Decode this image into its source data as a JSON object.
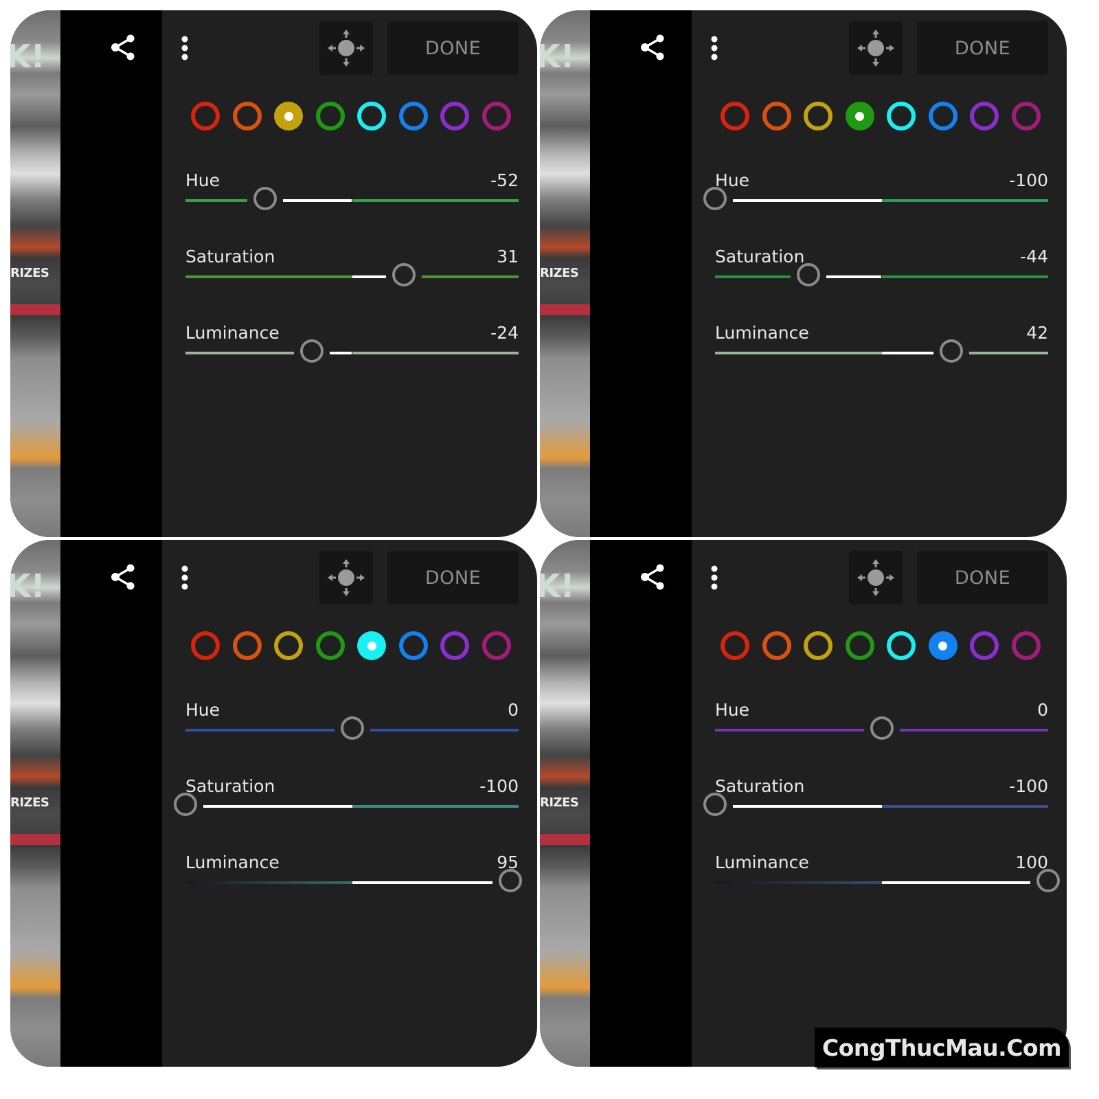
{
  "screens": [
    {
      "id": "top-left",
      "toolbar": {
        "done_label": "DONE"
      },
      "swatches": [
        {
          "name": "red",
          "color": "#d8240e"
        },
        {
          "name": "orange",
          "color": "#d9520f"
        },
        {
          "name": "yellow",
          "color": "#c2a20f",
          "active": true
        },
        {
          "name": "green",
          "color": "#1f9a12"
        },
        {
          "name": "aqua",
          "color": "#19f0f2"
        },
        {
          "name": "blue",
          "color": "#1282f0"
        },
        {
          "name": "purple",
          "color": "#8a2ecc"
        },
        {
          "name": "magenta",
          "color": "#a31c78"
        }
      ],
      "sliders": [
        {
          "label": "Hue",
          "value": -52,
          "display": "-52",
          "track_color": "#37a24b"
        },
        {
          "label": "Saturation",
          "value": 31,
          "display": "31",
          "track_color": "#4f9a26"
        },
        {
          "label": "Luminance",
          "value": -24,
          "display": "-24",
          "track_color": "#9cb397"
        }
      ]
    },
    {
      "id": "top-right",
      "toolbar": {
        "done_label": "DONE"
      },
      "swatches": [
        {
          "name": "red",
          "color": "#d8240e"
        },
        {
          "name": "orange",
          "color": "#d9520f"
        },
        {
          "name": "yellow",
          "color": "#c2a20f"
        },
        {
          "name": "green",
          "color": "#1f9a12",
          "active": true
        },
        {
          "name": "aqua",
          "color": "#19f0f2"
        },
        {
          "name": "blue",
          "color": "#1282f0"
        },
        {
          "name": "purple",
          "color": "#8a2ecc"
        },
        {
          "name": "magenta",
          "color": "#a31c78"
        }
      ],
      "sliders": [
        {
          "label": "Hue",
          "value": -100,
          "display": "-100",
          "track_color": "#2f9c58"
        },
        {
          "label": "Saturation",
          "value": -44,
          "display": "-44",
          "track_color": "#27953f"
        },
        {
          "label": "Luminance",
          "value": 42,
          "display": "42",
          "track_color": "#92b896"
        }
      ]
    },
    {
      "id": "bottom-left",
      "toolbar": {
        "done_label": "DONE"
      },
      "swatches": [
        {
          "name": "red",
          "color": "#d8240e"
        },
        {
          "name": "orange",
          "color": "#d9520f"
        },
        {
          "name": "yellow",
          "color": "#c2a20f"
        },
        {
          "name": "green",
          "color": "#1f9a12"
        },
        {
          "name": "aqua",
          "color": "#19f0f2",
          "active": true
        },
        {
          "name": "blue",
          "color": "#1282f0"
        },
        {
          "name": "purple",
          "color": "#8a2ecc"
        },
        {
          "name": "magenta",
          "color": "#a31c78"
        }
      ],
      "sliders": [
        {
          "label": "Hue",
          "value": 0,
          "display": "0",
          "track_color": "#2f4fa8"
        },
        {
          "label": "Saturation",
          "value": -100,
          "display": "-100",
          "track_color": "#3a8a80"
        },
        {
          "label": "Luminance",
          "value": 95,
          "display": "95",
          "track_color": "#3d6b66"
        }
      ]
    },
    {
      "id": "bottom-right",
      "toolbar": {
        "done_label": "DONE"
      },
      "swatches": [
        {
          "name": "red",
          "color": "#d8240e"
        },
        {
          "name": "orange",
          "color": "#d9520f"
        },
        {
          "name": "yellow",
          "color": "#c2a20f"
        },
        {
          "name": "green",
          "color": "#1f9a12"
        },
        {
          "name": "aqua",
          "color": "#19f0f2"
        },
        {
          "name": "blue",
          "color": "#1282f0",
          "active": true
        },
        {
          "name": "purple",
          "color": "#8a2ecc"
        },
        {
          "name": "magenta",
          "color": "#a31c78"
        }
      ],
      "sliders": [
        {
          "label": "Hue",
          "value": 0,
          "display": "0",
          "track_color": "#7a35b5"
        },
        {
          "label": "Saturation",
          "value": -100,
          "display": "-100",
          "track_color": "#3d4f8c"
        },
        {
          "label": "Luminance",
          "value": 100,
          "display": "100",
          "track_color": "#3a4a70"
        }
      ]
    }
  ],
  "slider_range": [
    -100,
    100
  ],
  "photo_strip": {
    "text": "RIZES",
    "mark": "K!"
  },
  "watermark": "CongThucMau.Com"
}
